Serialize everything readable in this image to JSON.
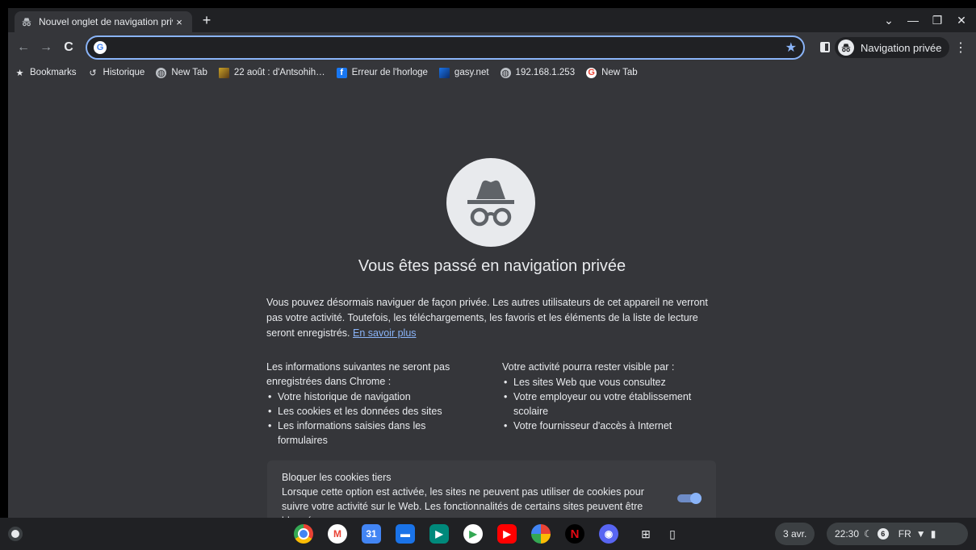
{
  "tab": {
    "title": "Nouvel onglet de navigation privée",
    "close": "×"
  },
  "tabstrip": {
    "new_tab": "+",
    "chevron": "⌄",
    "minimize": "—",
    "restore": "❐",
    "close": "✕"
  },
  "toolbar": {
    "back": "←",
    "forward": "→",
    "reload": "C",
    "omnibox_value": "",
    "star": "★",
    "incognito_label": "Navigation privée",
    "menu": "⋮"
  },
  "bookmarks": [
    {
      "label": "Bookmarks",
      "icon": "star-icon"
    },
    {
      "label": "Historique",
      "icon": "history-icon"
    },
    {
      "label": "New Tab",
      "icon": "globe-icon"
    },
    {
      "label": "22 août : d'Antsohih…",
      "icon": "site-image-icon"
    },
    {
      "label": "Erreur de l'horloge",
      "icon": "facebook-icon"
    },
    {
      "label": "gasy.net",
      "icon": "gasy-icon"
    },
    {
      "label": "192.168.1.253",
      "icon": "globe-icon"
    },
    {
      "label": "New Tab",
      "icon": "google-icon"
    }
  ],
  "main": {
    "headline": "Vous êtes passé en navigation privée",
    "intro": "Vous pouvez désormais naviguer de façon privée. Les autres utilisateurs de cet appareil ne verront pas votre activité. Toutefois, les téléchargements, les favoris et les éléments de la liste de lecture seront enregistrés.",
    "learn_more": "En savoir plus",
    "not_saved": {
      "heading_pre": "Les informations suivantes ",
      "heading_bold": "ne seront pas",
      "heading_post": " enregistrées dans Chrome :",
      "items": [
        "Votre historique de navigation",
        "Les cookies et les données des sites",
        "Les informations saisies dans les formulaires"
      ]
    },
    "visible": {
      "heading_pre": "Votre activité ",
      "heading_bold": "pourra rester visible",
      "heading_post": " par :",
      "items": [
        "Les sites Web que vous consultez",
        "Votre employeur ou votre établissement scolaire",
        "Votre fournisseur d'accès à Internet"
      ]
    },
    "cookies": {
      "title": "Bloquer les cookies tiers",
      "description": "Lorsque cette option est activée, les sites ne peuvent pas utiliser de cookies pour suivre votre activité sur le Web. Les fonctionnalités de certains sites peuvent être bloquées.",
      "enabled": true
    }
  },
  "shelf": {
    "date": "3 avr.",
    "time": "22:30",
    "notification_count": "6",
    "language": "FR"
  },
  "colors": {
    "accent": "#8ab4f8",
    "background": "#35363a",
    "shelf": "#202124"
  }
}
